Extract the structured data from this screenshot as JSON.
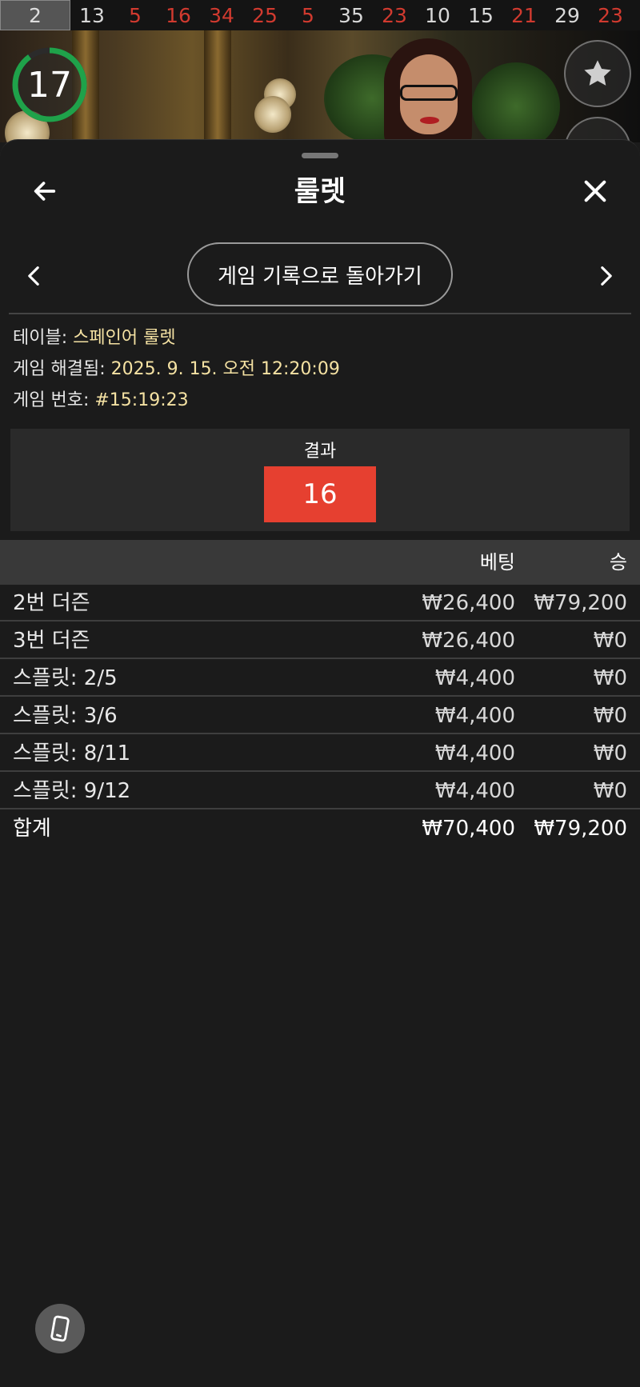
{
  "history": [
    {
      "value": "2",
      "color": "first"
    },
    {
      "value": "13",
      "color": "black"
    },
    {
      "value": "5",
      "color": "red"
    },
    {
      "value": "16",
      "color": "red"
    },
    {
      "value": "34",
      "color": "red"
    },
    {
      "value": "25",
      "color": "red"
    },
    {
      "value": "5",
      "color": "red"
    },
    {
      "value": "35",
      "color": "black"
    },
    {
      "value": "23",
      "color": "red"
    },
    {
      "value": "10",
      "color": "black"
    },
    {
      "value": "15",
      "color": "black"
    },
    {
      "value": "21",
      "color": "red"
    },
    {
      "value": "29",
      "color": "black"
    },
    {
      "value": "23",
      "color": "red"
    }
  ],
  "timer": {
    "value": "17",
    "progress": 0.9,
    "color": "#1fa24a"
  },
  "header": {
    "title": "룰렛"
  },
  "nav": {
    "back_to_history": "게임 기록으로 돌아가기"
  },
  "info": {
    "table_label": "테이블: ",
    "table_value": "스페인어 룰렛",
    "resolved_label": "게임 해결됨: ",
    "resolved_value": "2025. 9. 15. 오전 12:20:09",
    "game_no_label": "게임 번호: ",
    "game_no_value": "#15:19:23"
  },
  "result": {
    "label": "결과",
    "number": "16",
    "color": "#e64030"
  },
  "table": {
    "headers": {
      "bet": "베팅",
      "win": "승"
    },
    "rows": [
      {
        "name": "2번 더즌",
        "bet": "₩26,400",
        "win": "₩79,200"
      },
      {
        "name": "3번 더즌",
        "bet": "₩26,400",
        "win": "₩0"
      },
      {
        "name": "스플릿: 2/5",
        "bet": "₩4,400",
        "win": "₩0"
      },
      {
        "name": "스플릿: 3/6",
        "bet": "₩4,400",
        "win": "₩0"
      },
      {
        "name": "스플릿: 8/11",
        "bet": "₩4,400",
        "win": "₩0"
      },
      {
        "name": "스플릿: 9/12",
        "bet": "₩4,400",
        "win": "₩0"
      }
    ],
    "total": {
      "name": "합계",
      "bet": "₩70,400",
      "win": "₩79,200"
    }
  },
  "icons": {
    "back": "arrow-left-icon",
    "close": "close-icon",
    "prev": "chevron-left-icon",
    "next": "chevron-right-icon",
    "favorite": "star-icon",
    "device": "phone-rotate-icon"
  }
}
